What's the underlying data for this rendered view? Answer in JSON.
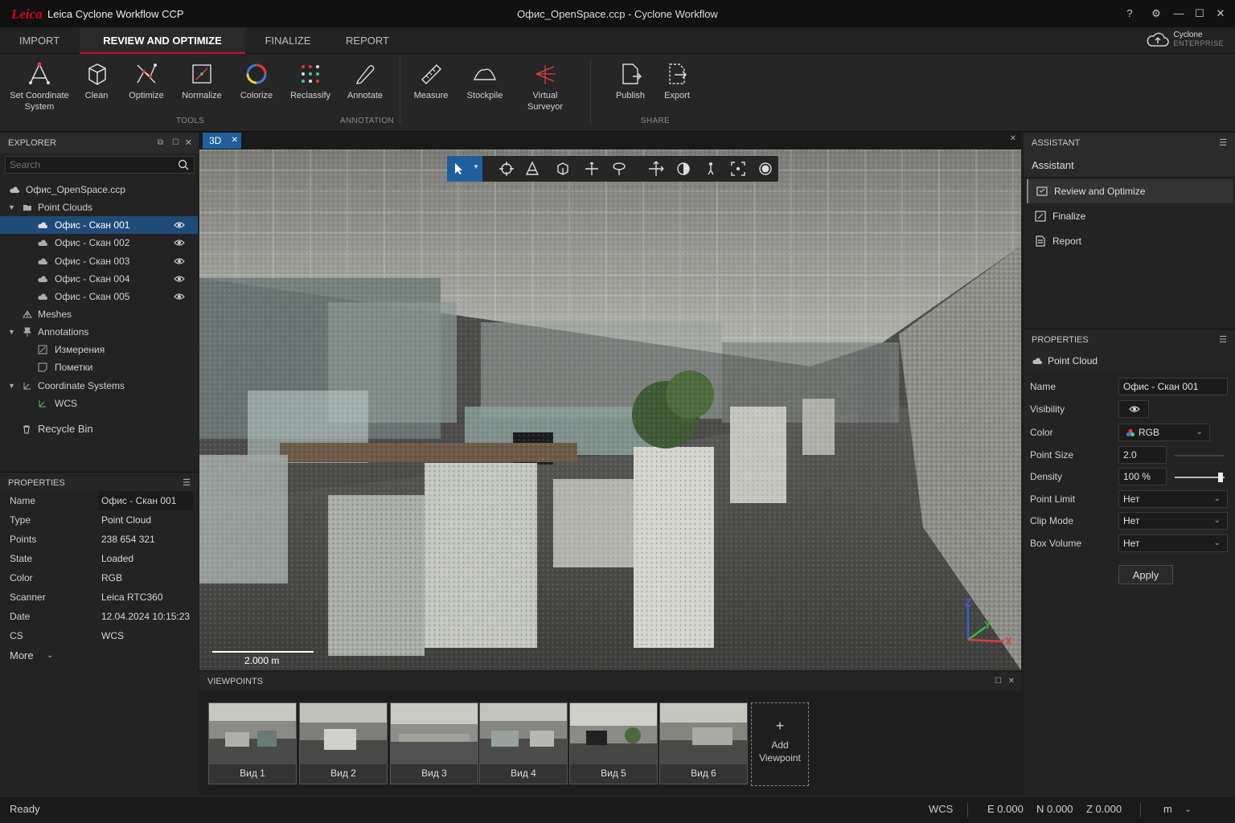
{
  "titlebar": {
    "logo": "Leica",
    "app_name": "Leica Cyclone Workflow CCP",
    "document_title": "Офис_OpenSpace.ccp - Cyclone Workflow"
  },
  "tabs": [
    {
      "label": "IMPORT"
    },
    {
      "label": "REVIEW AND OPTIMIZE"
    },
    {
      "label": "FINALIZE"
    },
    {
      "label": "REPORT"
    }
  ],
  "cyclone": {
    "line1": "Cyclone",
    "line2": "ENTERPRISE"
  },
  "ribbon": {
    "tools": [
      {
        "label": "Set Coordinate\nSystem",
        "icon": "coordinate-system-icon"
      },
      {
        "label": "Clean",
        "icon": "cube-icon"
      },
      {
        "label": "Optimize",
        "icon": "optimize-icon"
      },
      {
        "label": "Normalize",
        "icon": "normalize-icon"
      },
      {
        "label": "Colorize",
        "icon": "colorize-icon"
      },
      {
        "label": "Reclassify",
        "icon": "reclassify-icon"
      }
    ],
    "annotation": [
      {
        "label": "Annotate",
        "icon": "pen-icon"
      }
    ],
    "measure": [
      {
        "label": "Measure",
        "icon": "ruler-icon"
      },
      {
        "label": "Stockpile",
        "icon": "stockpile-icon"
      },
      {
        "label": "Virtual\nSurveyor",
        "icon": "surveyor-icon"
      }
    ],
    "share": [
      {
        "label": "Publish",
        "icon": "publish-icon"
      },
      {
        "label": "Export",
        "icon": "export-icon"
      }
    ],
    "group_tools": "TOOLS",
    "group_annotation": "ANNOTATION",
    "group_share": "SHARE"
  },
  "explorer": {
    "title": "EXPLORER",
    "search_placeholder": "Search",
    "project": "Офис_OpenSpace.ccp",
    "point_clouds": "Point Clouds",
    "scans": [
      "Офис - Скан 001",
      "Офис - Скан 002",
      "Офис - Скан 003",
      "Офис - Скан 004",
      "Офис - Скан 005"
    ],
    "meshes": "Meshes",
    "annotations": "Annotations",
    "annotation_items": [
      "Измерения",
      "Пометки"
    ],
    "coordinate_systems": "Coordinate Systems",
    "wcs": "WCS",
    "recycle_bin": "Recycle Bin"
  },
  "properties_left": {
    "title": "PROPERTIES",
    "rows": [
      {
        "k": "Name",
        "v": "Офис - Скан 001"
      },
      {
        "k": "Type",
        "v": "Point Cloud"
      },
      {
        "k": "Points",
        "v": "238 654 321"
      },
      {
        "k": "State",
        "v": "Loaded"
      },
      {
        "k": "Color",
        "v": "RGB"
      },
      {
        "k": "Scanner",
        "v": "Leica RTC360"
      },
      {
        "k": "Date",
        "v": "12.04.2024 10:15:23"
      },
      {
        "k": "CS",
        "v": "WCS"
      }
    ],
    "more": "More"
  },
  "viewport": {
    "tab": "3D",
    "scale": "2.000 m",
    "axis_x": "X",
    "axis_y": "Y",
    "axis_z": "Z"
  },
  "viewpoints": {
    "title": "VIEWPOINTS",
    "items": [
      "Вид 1",
      "Вид 2",
      "Вид 3",
      "Вид 4",
      "Вид 5",
      "Вид 6"
    ],
    "add": "Add\nViewpoint"
  },
  "assistant": {
    "title": "ASSISTANT",
    "subtitle": "Assistant",
    "items": [
      "Review and Optimize",
      "Finalize",
      "Report"
    ]
  },
  "properties_right": {
    "title": "PROPERTIES",
    "subtitle": "Point Cloud",
    "name_label": "Name",
    "name_value": "Офис - Скан 001",
    "visibility_label": "Visibility",
    "color_label": "Color",
    "color_value": "RGB",
    "point_size_label": "Point Size",
    "point_size_value": "2.0",
    "density_label": "Density",
    "density_value": "100 %",
    "density_level": 1.0,
    "point_limit_label": "Point Limit",
    "point_limit_value": "Нет",
    "clip_mode_label": "Clip Mode",
    "clip_mode_value": "Нет",
    "box_volume_label": "Box Volume",
    "box_volume_value": "Нет",
    "apply": "Apply"
  },
  "status": {
    "text": "Ready",
    "cs": "WCS",
    "e": "E 0.000",
    "n": "N 0.000",
    "z": "Z 0.000",
    "unit": "m"
  },
  "colors": {
    "accent": "#c8102e",
    "selection": "#1f4b78",
    "tab3d": "#1f5f9e"
  }
}
